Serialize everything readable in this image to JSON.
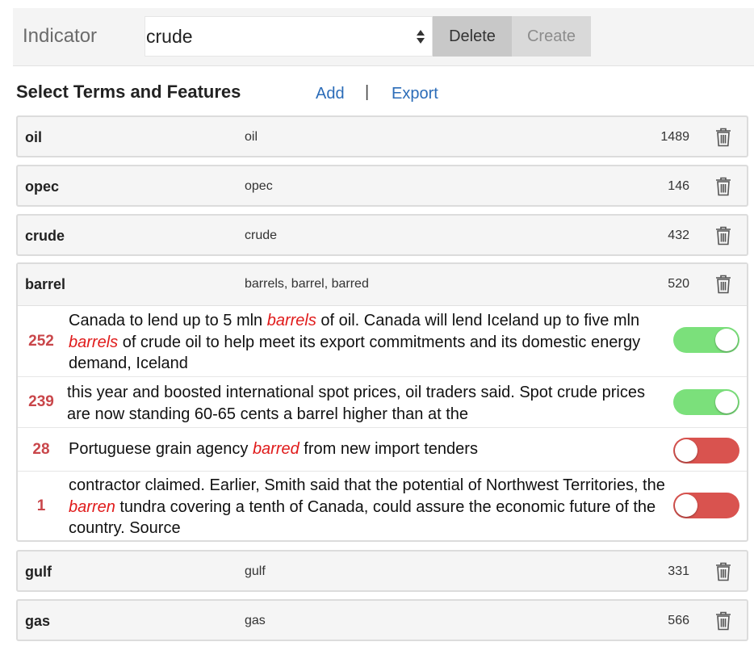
{
  "indicator": {
    "label": "Indicator",
    "selected": "crude",
    "delete_label": "Delete",
    "create_label": "Create"
  },
  "section": {
    "title": "Select Terms and Features",
    "add_label": "Add",
    "separator": "|",
    "export_label": "Export"
  },
  "terms": [
    {
      "name": "oil",
      "features": "oil",
      "count": "1489"
    },
    {
      "name": "opec",
      "features": "opec",
      "count": "146"
    },
    {
      "name": "crude",
      "features": "crude",
      "count": "432"
    },
    {
      "name": "barrel",
      "features": "barrels, barrel, barred",
      "count": "520"
    },
    {
      "name": "gulf",
      "features": "gulf",
      "count": "331"
    },
    {
      "name": "gas",
      "features": "gas",
      "count": "566"
    }
  ],
  "snippets": [
    {
      "count": "252",
      "parts": [
        "Canada to lend up to 5 mln ",
        "barrels",
        " of oil. Canada will lend Iceland up to five mln ",
        "barrels",
        " of crude oil to help meet its export commitments and its domestic energy demand, Iceland"
      ],
      "enabled": true
    },
    {
      "count": "239",
      "parts": [
        "this year and boosted international spot prices, oil traders said. Spot crude prices are now standing 60-65 cents a barrel higher than at the"
      ],
      "enabled": true
    },
    {
      "count": "28",
      "parts": [
        "Portuguese grain agency ",
        "barred",
        " from new import tenders"
      ],
      "enabled": false
    },
    {
      "count": "1",
      "parts": [
        "contractor claimed. Earlier, Smith said that the potential of Northwest Territories, the ",
        "barren",
        " tundra covering a tenth of Canada, could assure the economic future of the country. Source"
      ],
      "enabled": false
    }
  ],
  "colors": {
    "link": "#2b6cb8",
    "highlight": "#e01b1b",
    "count": "#c9464a",
    "toggle_on": "#7be07b",
    "toggle_off": "#d9534f"
  },
  "icons": {
    "delete_term": "trash-icon",
    "select": "select-arrows-icon"
  }
}
